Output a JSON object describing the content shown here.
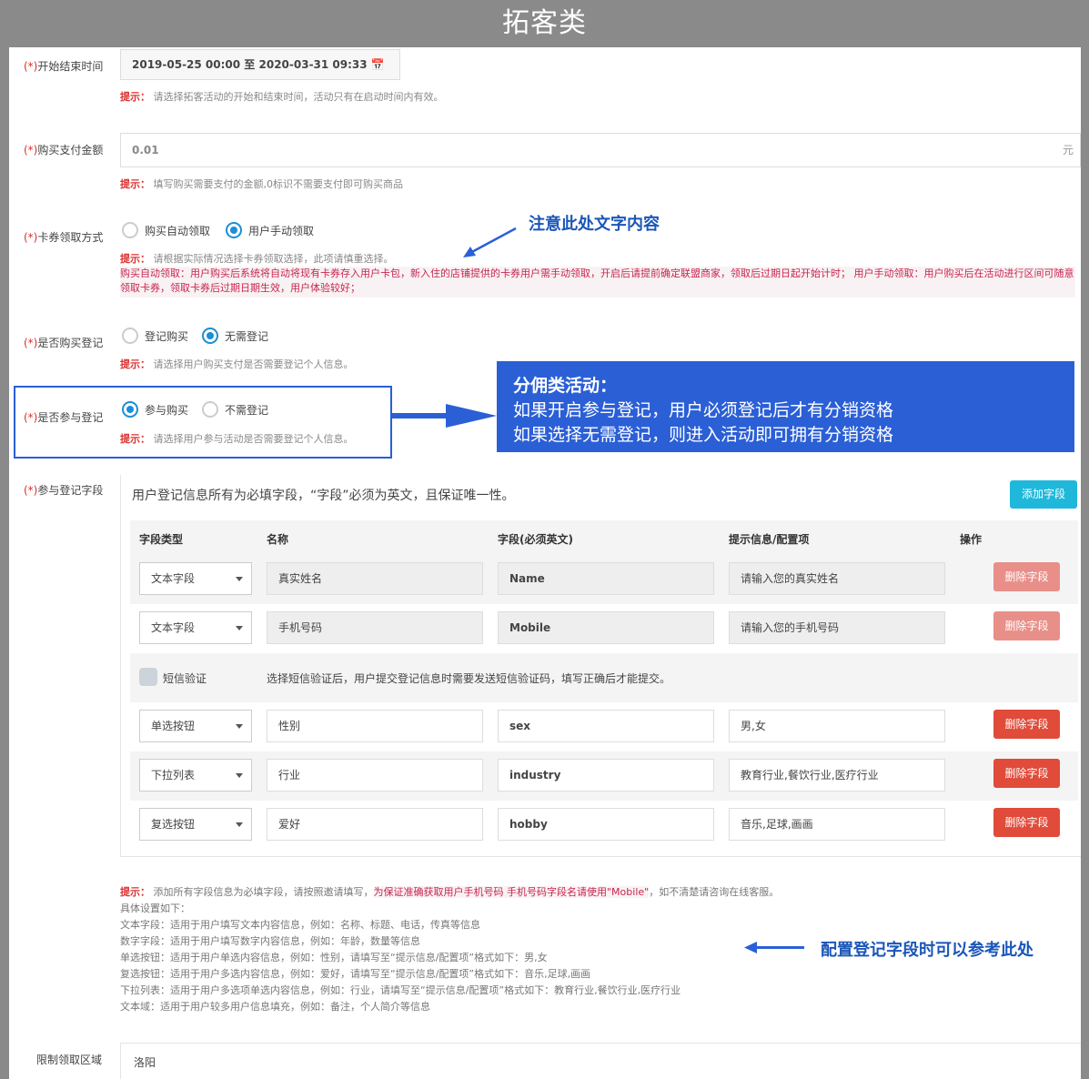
{
  "banner_title": "拓客类",
  "fields": {
    "time": {
      "label": "开始结束时间",
      "value": "2019-05-25 00:00 至 2020-03-31 09:33",
      "tip": "请选择拓客活动的开始和结束时间，活动只有在启动时间内有效。"
    },
    "amount": {
      "label": "购买支付金额",
      "value": "0.01",
      "unit": "元",
      "tip": "填写购买需要支付的金额,0标识不需要支付即可购买商品"
    },
    "card": {
      "label": "卡券领取方式",
      "option1": "购买自动领取",
      "option2": "用户手动领取",
      "selected": "option2",
      "tip": "请根据实际情况选择卡券领取选择，此项请慎重选择。",
      "warning": "购买自动领取：用户购买后系统将自动将现有卡券存入用户卡包，新入住的店铺提供的卡券用户需手动领取，开启后请提前确定联盟商家，领取后过期日起开始计时；  用户手动领取：用户购买后在活动进行区间可随意领取卡券，领取卡券后过期日期生效，用户体验较好；"
    },
    "buy_register": {
      "label": "是否购买登记",
      "option1": "登记购买",
      "option2": "无需登记",
      "selected": "option2",
      "tip": "请选择用户购买支付是否需要登记个人信息。"
    },
    "join_register": {
      "label": "是否参与登记",
      "option1": "参与购买",
      "option2": "不需登记",
      "selected": "option1",
      "tip": "请选择用户参与活动是否需要登记个人信息。"
    },
    "reg_fields": {
      "label": "参与登记字段"
    },
    "region": {
      "label": "限制领取区域",
      "value": "洛阳"
    }
  },
  "required_mark": "(*)",
  "tip_prefix": "提示：",
  "callouts": {
    "text_notice": "注意此处文字内容",
    "config_notice": "配置登记字段时可以参考此处",
    "box_title": "分佣类活动：",
    "box_line1": "如果开启参与登记，用户必须登记后才有分销资格",
    "box_line2": "如果选择无需登记，则进入活动即可拥有分销资格"
  },
  "table": {
    "intro": "用户登记信息所有为必填字段，“字段”必须为英文，且保证唯一性。",
    "add_button": "添加字段",
    "headers": [
      "字段类型",
      "名称",
      "字段(必须英文)",
      "提示信息/配置项",
      "操作"
    ],
    "delete_label": "删除字段",
    "rows": [
      {
        "type": "文本字段",
        "name": "真实姓名",
        "field": "Name",
        "hint": "请输入您的真实姓名",
        "locked": true
      },
      {
        "type": "文本字段",
        "name": "手机号码",
        "field": "Mobile",
        "hint": "请输入您的手机号码",
        "locked": true
      },
      {
        "type": "单选按钮",
        "name": "性别",
        "field": "sex",
        "hint": "男,女",
        "locked": false
      },
      {
        "type": "下拉列表",
        "name": "行业",
        "field": "industry",
        "hint": "教育行业,餐饮行业,医疗行业",
        "locked": false
      },
      {
        "type": "复选按钮",
        "name": "爱好",
        "field": "hobby",
        "hint": "音乐,足球,画画",
        "locked": false
      }
    ],
    "sms_label": "短信验证",
    "sms_desc": "选择短信验证后，用户提交登记信息时需要发送短信验证码，填写正确后才能提交。"
  },
  "notes": {
    "line1a": "添加所有字段信息为必填字段，请按照邀请填写，",
    "line1code": "为保证准确获取用户手机号码 手机号码字段名请使用\"Mobile\"",
    "line1b": "，如不清楚请咨询在线客服。",
    "line2": "具体设置如下：",
    "line3": "文本字段：适用于用户填写文本内容信息，例如：名称、标题、电话，传真等信息",
    "line4": "数字字段：适用于用户填写数字内容信息，例如：年龄，数量等信息",
    "line5": "单选按钮：适用于用户单选内容信息，例如：性别，请填写至“提示信息/配置项”格式如下：男,女",
    "line6": "复选按钮：适用于用户多选内容信息，例如：爱好，请填写至“提示信息/配置项”格式如下：音乐,足球,画画",
    "line7": "下拉列表：适用于用户多选项单选内容信息，例如：行业，请填写至“提示信息/配置项”格式如下：教育行业,餐饮行业,医疗行业",
    "line8": "文本域：适用于用户较多用户信息填充，例如：备注，个人简介等信息"
  }
}
